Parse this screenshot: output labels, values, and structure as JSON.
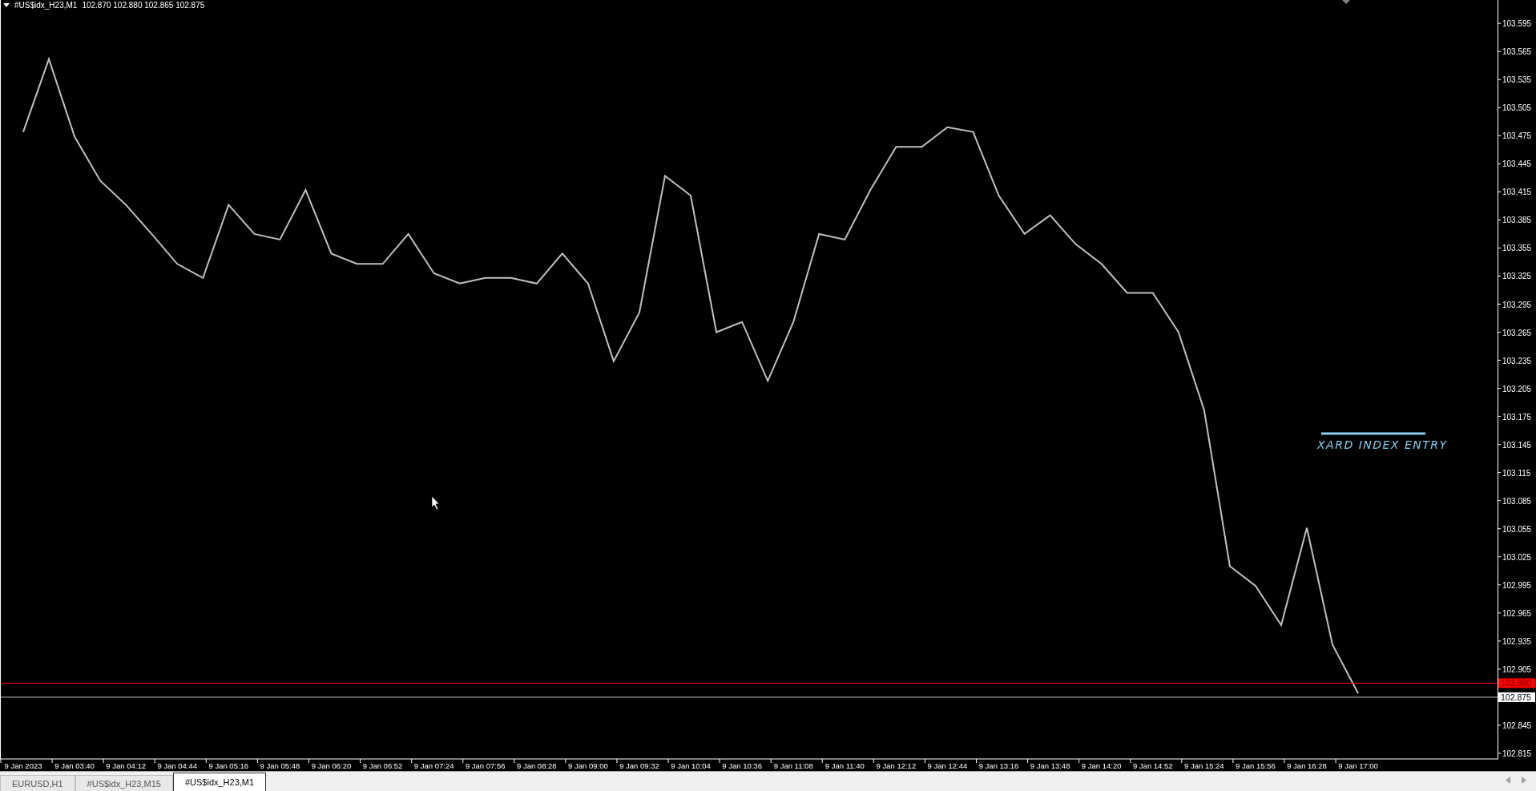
{
  "header": {
    "symbol": "#US$idx_H23,M1",
    "ohlc": "102.870 102.880 102.865 102.875"
  },
  "chart": {
    "chart_data": {
      "type": "line",
      "categories": [
        "9 Jan 2023",
        null,
        "9 Jan 03:40",
        null,
        "9 Jan 04:12",
        null,
        "9 Jan 04:44",
        null,
        "9 Jan 05:16",
        null,
        "9 Jan 05:48",
        null,
        "9 Jan 06:20",
        null,
        "9 Jan 06:52",
        null,
        "9 Jan 07:24",
        null,
        "9 Jan 07:56",
        null,
        "9 Jan 08:28",
        null,
        "9 Jan 09:00",
        null,
        "9 Jan 09:32",
        null,
        "9 Jan 10:04",
        null,
        "9 Jan 10:36",
        null,
        "9 Jan 11:08",
        null,
        "9 Jan 11:40",
        null,
        "9 Jan 12:12",
        null,
        "9 Jan 12:44",
        null,
        "9 Jan 13:16",
        null,
        "9 Jan 13:48",
        null,
        "9 Jan 14:20",
        null,
        "9 Jan 14:52",
        null,
        "9 Jan 15:24",
        null,
        "9 Jan 15:56",
        null,
        "9 Jan 16:28",
        null,
        "9 Jan 17:00"
      ],
      "series": [
        {
          "color": "#c0c0c0",
          "values": [
            103.479,
            103.557,
            103.474,
            103.427,
            103.401,
            103.37,
            103.338,
            103.323,
            103.401,
            103.37,
            103.364,
            103.417,
            103.349,
            103.338,
            103.338,
            103.37,
            103.328,
            103.317,
            103.323,
            103.323,
            103.317,
            103.349,
            103.317,
            103.234,
            103.286,
            103.432,
            103.411,
            103.265,
            103.276,
            103.213,
            103.276,
            103.37,
            103.364,
            103.417,
            103.463,
            103.463,
            103.484,
            103.479,
            103.411,
            103.37,
            103.39,
            103.359,
            103.338,
            103.307,
            103.307,
            103.265,
            103.182,
            103.015,
            102.994,
            102.952,
            103.056,
            102.931,
            102.879
          ]
        }
      ],
      "ylim": [
        102.809,
        103.62
      ],
      "yticks": [
        {
          "value": 103.595,
          "label": "103.595"
        },
        {
          "value": 103.565,
          "label": "103.565"
        },
        {
          "value": 103.535,
          "label": "103.535"
        },
        {
          "value": 103.505,
          "label": "103.505"
        },
        {
          "value": 103.475,
          "label": "103.475"
        },
        {
          "value": 103.445,
          "label": "103.445"
        },
        {
          "value": 103.415,
          "label": "103.415"
        },
        {
          "value": 103.385,
          "label": "103.385"
        },
        {
          "value": 103.355,
          "label": "103.355"
        },
        {
          "value": 103.325,
          "label": "103.325"
        },
        {
          "value": 103.295,
          "label": "103.295"
        },
        {
          "value": 103.265,
          "label": "103.265"
        },
        {
          "value": 103.235,
          "label": "103.235"
        },
        {
          "value": 103.205,
          "label": "103.205"
        },
        {
          "value": 103.175,
          "label": "103.175"
        },
        {
          "value": 103.145,
          "label": "103.145"
        },
        {
          "value": 103.115,
          "label": "103.115"
        },
        {
          "value": 103.085,
          "label": "103.085"
        },
        {
          "value": 103.055,
          "label": "103.055"
        },
        {
          "value": 103.025,
          "label": "103.025"
        },
        {
          "value": 102.995,
          "label": "102.995"
        },
        {
          "value": 102.965,
          "label": "102.965"
        },
        {
          "value": 102.935,
          "label": "102.935"
        },
        {
          "value": 102.905,
          "label": "102.905"
        },
        {
          "value": 102.845,
          "label": "102.845"
        },
        {
          "value": 102.815,
          "label": "102.815"
        }
      ],
      "ref_lines": [
        {
          "axis": "y",
          "value": 102.89,
          "label": "102.890",
          "color": "#ff0000"
        },
        {
          "axis": "y",
          "value": 102.875,
          "label": "102.875",
          "color": "#c0c0c0"
        }
      ],
      "annotations": [
        "XARD INDEX ENTRY"
      ]
    }
  },
  "tabs": [
    {
      "label": "EURUSD,H1",
      "selected": false
    },
    {
      "label": "#US$idx_H23,M15",
      "selected": false
    },
    {
      "label": "#US$idx_H23,M1",
      "selected": true
    }
  ]
}
